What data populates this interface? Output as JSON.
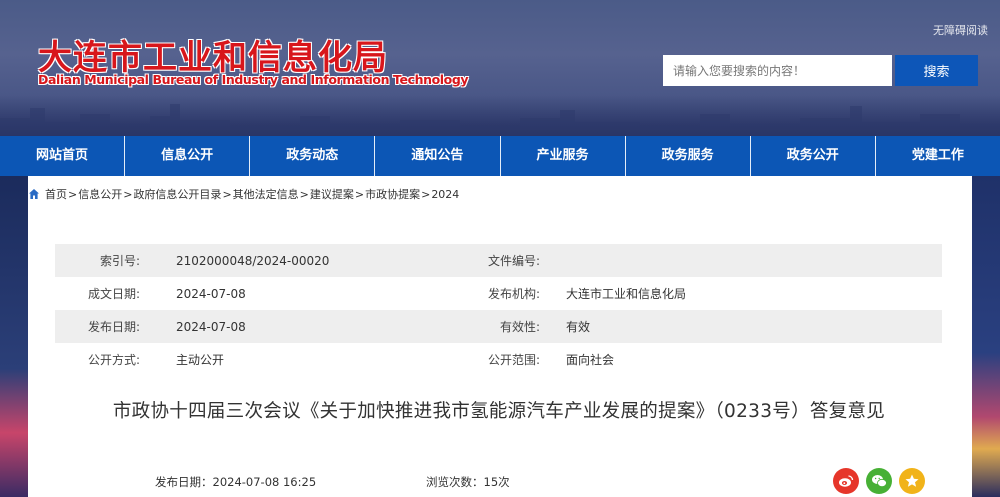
{
  "header": {
    "logo_cn": "大连市工业和信息化局",
    "logo_en": "Dalian Municipal Bureau of Industry and Information Technology",
    "accessible_link": "无障碍阅读",
    "search_placeholder": "请输入您要搜索的内容！",
    "search_button": "搜索"
  },
  "nav": {
    "items": [
      "网站首页",
      "信息公开",
      "政务动态",
      "通知公告",
      "产业服务",
      "政务服务",
      "政务公开",
      "党建工作"
    ]
  },
  "breadcrumb": {
    "items": [
      "首页",
      "信息公开",
      "政府信息公开目录",
      "其他法定信息",
      "建议提案",
      "市政协提案",
      "2024"
    ],
    "separator": ">"
  },
  "info": {
    "rows": [
      {
        "label1": "索引号:",
        "value1": "2102000048/2024-00020",
        "label2": "文件编号:",
        "value2": ""
      },
      {
        "label1": "成文日期:",
        "value1": "2024-07-08",
        "label2": "发布机构:",
        "value2": "大连市工业和信息化局"
      },
      {
        "label1": "发布日期:",
        "value1": "2024-07-08",
        "label2": "有效性:",
        "value2": "有效"
      },
      {
        "label1": "公开方式:",
        "value1": "主动公开",
        "label2": "公开范围:",
        "value2": "面向社会"
      }
    ]
  },
  "article": {
    "title": "市政协十四届三次会议《关于加快推进我市氢能源汽车产业发展的提案》（0233号）答复意见",
    "publish_label": "发布日期：",
    "publish_value": "2024-07-08  16:25",
    "views_label": "浏览次数：",
    "views_value": "15次"
  },
  "share": {
    "icons": [
      "weibo-icon",
      "wechat-icon",
      "favorite-star-icon"
    ]
  },
  "colors": {
    "brand_red": "#d8161b",
    "nav_blue": "#0c56b5",
    "search_blue": "#0d56b8"
  }
}
